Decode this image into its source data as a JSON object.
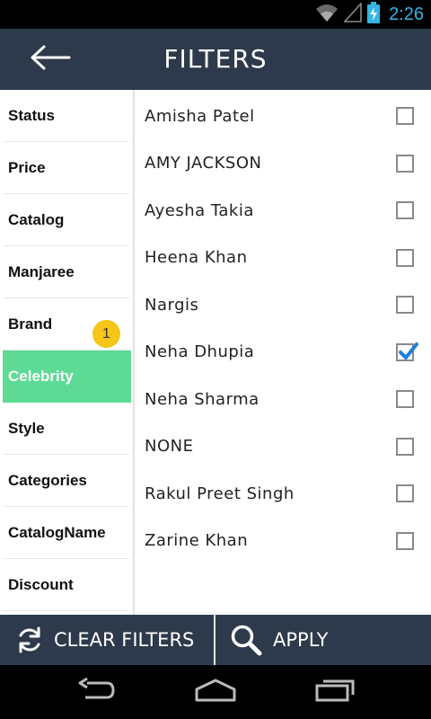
{
  "status_bar": {
    "time": "2:26",
    "icons": [
      "wifi-icon",
      "signal-icon",
      "battery-charging-icon"
    ],
    "accent": "#33b5e5"
  },
  "header": {
    "title": "FILTERS",
    "back_icon": "back-arrow-icon",
    "background": "#2d3a4b"
  },
  "sidebar": {
    "items": [
      {
        "label": "Status"
      },
      {
        "label": "Price"
      },
      {
        "label": "Catalog"
      },
      {
        "label": "Manjaree"
      },
      {
        "label": "Brand",
        "badge": "1"
      },
      {
        "label": "Celebrity",
        "active": true
      },
      {
        "label": "Style"
      },
      {
        "label": "Categories"
      },
      {
        "label": "CatalogName"
      },
      {
        "label": "Discount"
      }
    ],
    "active_color": "#5ddb95",
    "badge_color": "#f5c518"
  },
  "options": [
    {
      "label": "Amisha Patel",
      "checked": false
    },
    {
      "label": "AMY JACKSON",
      "checked": false
    },
    {
      "label": "Ayesha Takia",
      "checked": false
    },
    {
      "label": "Heena Khan",
      "checked": false
    },
    {
      "label": "Nargis",
      "checked": false
    },
    {
      "label": "Neha Dhupia",
      "checked": true
    },
    {
      "label": "Neha Sharma",
      "checked": false
    },
    {
      "label": "NONE",
      "checked": false
    },
    {
      "label": "Rakul Preet Singh",
      "checked": false
    },
    {
      "label": "Zarine Khan",
      "checked": false
    }
  ],
  "actions": {
    "clear_label": "CLEAR FILTERS",
    "clear_icon": "refresh-icon",
    "apply_label": "APPLY",
    "apply_icon": "search-icon"
  },
  "nav": {
    "icons": [
      "nav-back-icon",
      "nav-home-icon",
      "nav-recents-icon"
    ]
  },
  "colors": {
    "check_blue": "#1e7fd8"
  }
}
